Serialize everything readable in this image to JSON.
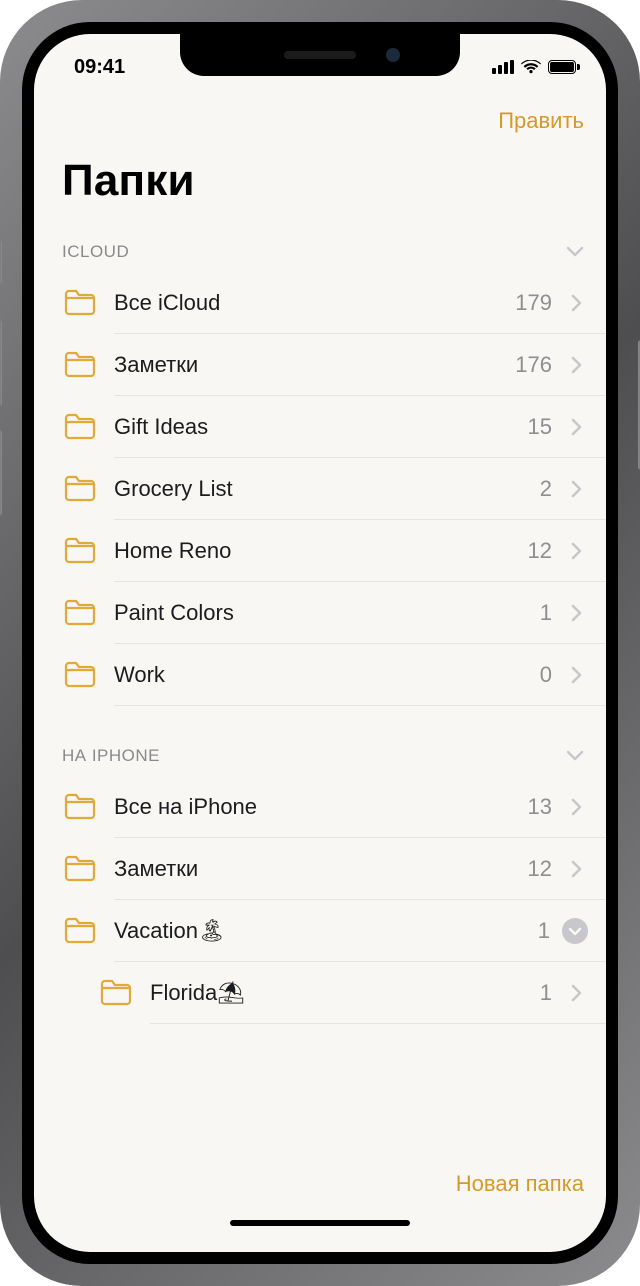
{
  "status": {
    "time": "09:41"
  },
  "nav": {
    "edit": "Править"
  },
  "title": "Папки",
  "sections": [
    {
      "header": "ICLOUD",
      "rows": [
        {
          "label": "Все iCloud",
          "count": "179",
          "indent": false,
          "expandBadge": false
        },
        {
          "label": "Заметки",
          "count": "176",
          "indent": false,
          "expandBadge": false
        },
        {
          "label": "Gift Ideas",
          "count": "15",
          "indent": false,
          "expandBadge": false
        },
        {
          "label": "Grocery List",
          "count": "2",
          "indent": false,
          "expandBadge": false
        },
        {
          "label": "Home Reno",
          "count": "12",
          "indent": false,
          "expandBadge": false
        },
        {
          "label": "Paint Colors",
          "count": "1",
          "indent": false,
          "expandBadge": false
        },
        {
          "label": "Work",
          "count": "0",
          "indent": false,
          "expandBadge": false
        }
      ]
    },
    {
      "header": "НА IPHONE",
      "rows": [
        {
          "label": "Все на iPhone",
          "count": "13",
          "indent": false,
          "expandBadge": false
        },
        {
          "label": "Заметки",
          "count": "12",
          "indent": false,
          "expandBadge": false
        },
        {
          "label": "Vacation🏝",
          "count": "1",
          "indent": false,
          "expandBadge": true
        },
        {
          "label": "Florida⛱",
          "count": "1",
          "indent": true,
          "expandBadge": false
        }
      ]
    }
  ],
  "toolbar": {
    "newFolder": "Новая папка"
  }
}
